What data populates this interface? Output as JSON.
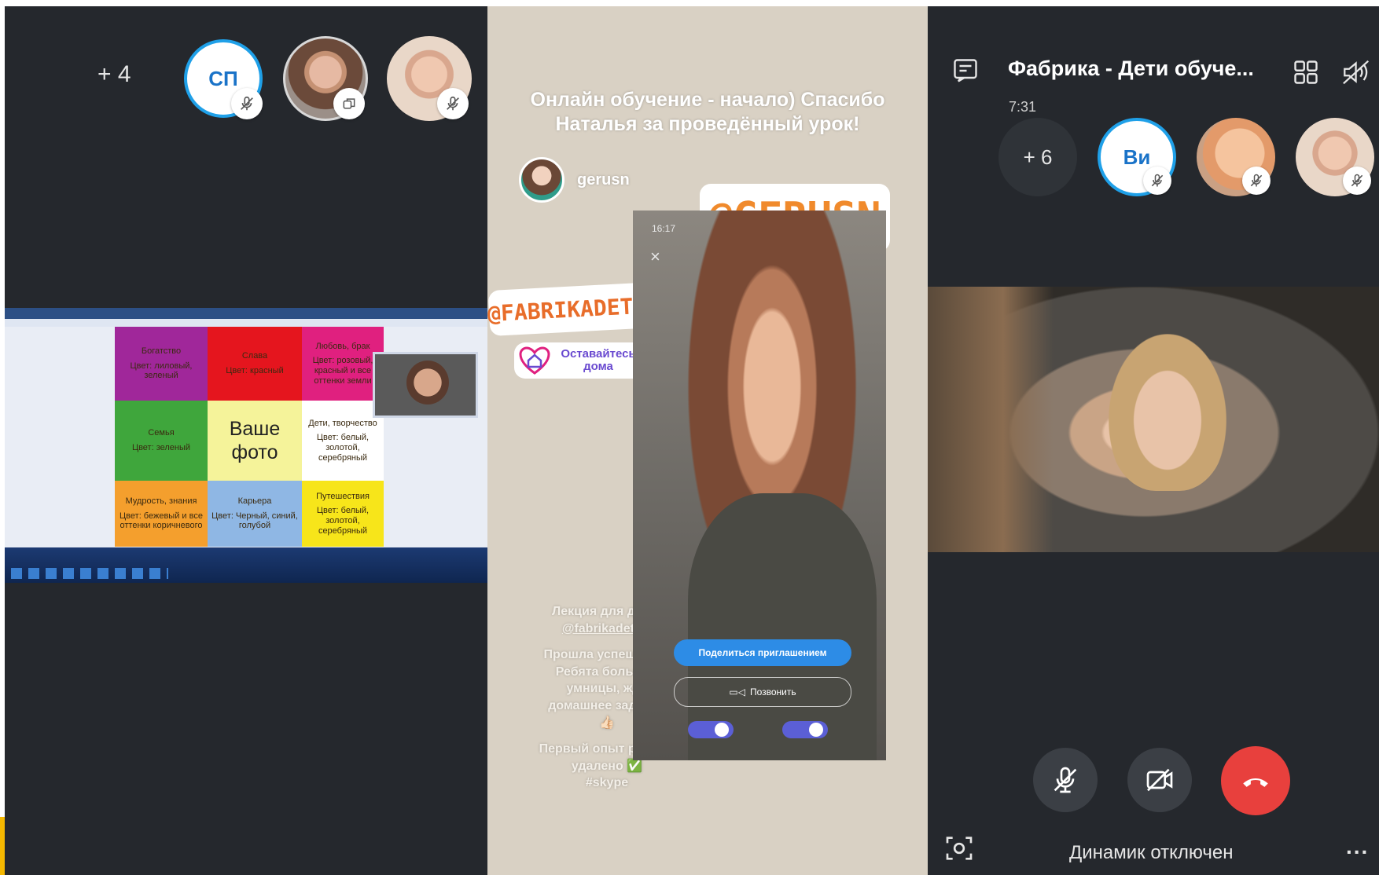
{
  "left_panel": {
    "overflow_count": "+ 4",
    "participants": [
      {
        "initials": "СП"
      },
      {
        "initials": ""
      },
      {
        "initials": ""
      }
    ],
    "shared_screen": {
      "grid": [
        {
          "title": "Богатство",
          "body": "Цвет: лиловый, зеленый",
          "color": "#a0279a"
        },
        {
          "title": "Слава",
          "body": "Цвет: красный",
          "color": "#e5151e"
        },
        {
          "title": "Любовь, брак",
          "body": "Цвет: розовый, красный и все оттенки земли",
          "color": "#e0207f"
        },
        {
          "title": "Семья",
          "body": "Цвет: зеленый",
          "color": "#3fa63c"
        },
        {
          "title": "Ваше фото",
          "body": "",
          "color": "#f5f39a"
        },
        {
          "title": "Дети, творчество",
          "body": "Цвет: белый, золотой, серебряный",
          "color": "#ffffff"
        },
        {
          "title": "Мудрость, знания",
          "body": "Цвет: бежевый и все оттенки коричневого",
          "color": "#f49f2d"
        },
        {
          "title": "Карьера",
          "body": "Цвет: Черный, синий, голубой",
          "color": "#8fb7e4"
        },
        {
          "title": "Путешествия",
          "body": "Цвет: белый, золотой, серебряный",
          "color": "#f7e51a"
        }
      ]
    }
  },
  "story": {
    "headline": "Онлайн обучение - начало) Спасибо Наталья за проведённый урок!",
    "username": "gerusn",
    "mention_large": "@GERUSN",
    "mention_brand": "@FABRIKADETI74",
    "sticker_label": "Оставайтесь дома",
    "phone_time": "16:17",
    "share_invite_button": "Поделиться приглашением",
    "call_button": "Позвонить",
    "caption_lines": [
      "Лекция для деток",
      "@fabrikadeti74",
      "Прошла успешно 👌",
      "Ребята большие",
      "умницы, жду",
      "домашнее задание",
      "👍🏻",
      "Первый опыт работы",
      "удалено ✅",
      "#skype"
    ]
  },
  "right_panel": {
    "call_title": "Фабрика - Дети обуче...",
    "call_duration": "7:31",
    "overflow_count": "+ 6",
    "participant_initials": "Ви",
    "status_text": "Динамик отключен",
    "more_label": "..."
  },
  "colors": {
    "panel_bg": "#25282d",
    "skype_blue": "#1fa0e8",
    "end_call_red": "#e8403d",
    "story_bg": "#d9d1c4",
    "mention_orange": "#e86d2a"
  }
}
